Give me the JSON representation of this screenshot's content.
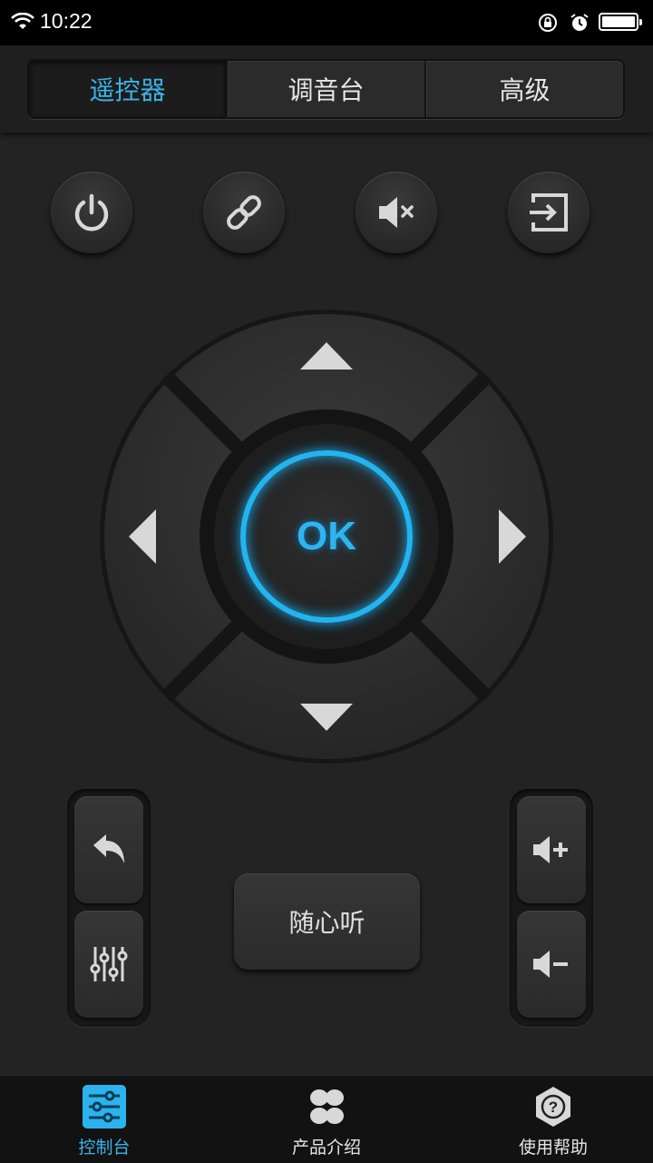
{
  "status": {
    "time": "10:22"
  },
  "tabs": [
    {
      "label": "遥控器",
      "active": true
    },
    {
      "label": "调音台",
      "active": false
    },
    {
      "label": "高级",
      "active": false
    }
  ],
  "remote": {
    "top_buttons": [
      "power-icon",
      "link-icon",
      "mute-icon",
      "input-source-icon"
    ],
    "ok_label": "OK",
    "listen_label": "随心听",
    "left_pod": [
      "back-icon",
      "equalizer-icon"
    ],
    "right_pod": [
      "volume-up-icon",
      "volume-down-icon"
    ]
  },
  "bottom_nav": [
    {
      "label": "控制台",
      "icon": "control-panel-icon",
      "active": true
    },
    {
      "label": "产品介绍",
      "icon": "product-icon",
      "active": false
    },
    {
      "label": "使用帮助",
      "icon": "help-icon",
      "active": false
    }
  ],
  "colors": {
    "accent": "#2eb4ee",
    "background": "#232323"
  }
}
